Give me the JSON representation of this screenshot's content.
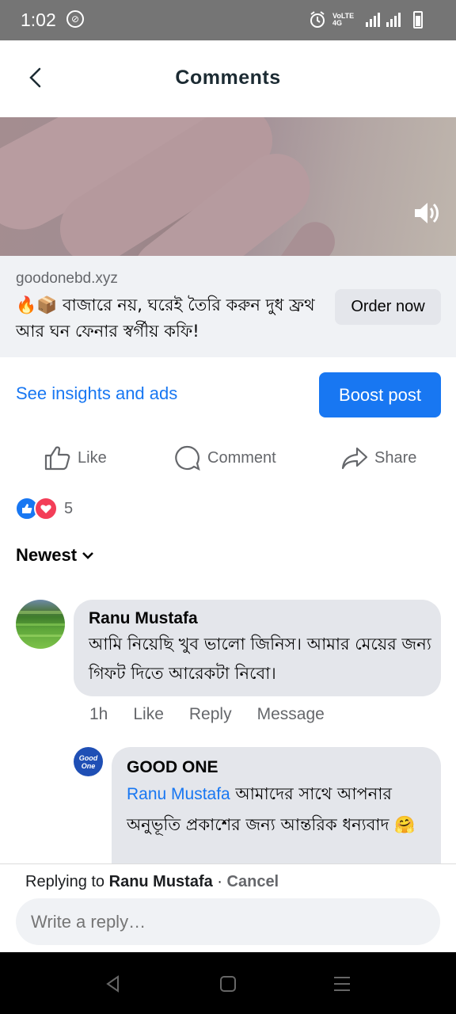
{
  "status": {
    "time": "1:02",
    "network_label": "VoLTE 4G"
  },
  "header": {
    "title": "Comments"
  },
  "ad": {
    "domain": "goodonebd.xyz",
    "emojis": "🔥📦",
    "text": "বাজারে নয়, ঘরেই তৈরি করুন দুধ ফ্রথ আর ঘন ফেনার স্বর্গীয় কফি!",
    "cta": "Order now"
  },
  "insights": {
    "link": "See insights and ads",
    "boost": "Boost post"
  },
  "actions": {
    "like": "Like",
    "comment": "Comment",
    "share": "Share"
  },
  "reactions": {
    "count": "5"
  },
  "sort": {
    "label": "Newest"
  },
  "comments": [
    {
      "author": "Ranu Mustafa",
      "text": "আমি নিয়েছি খুব ভালো জিনিস। আমার মেয়ের জন্য গিফট দিতে আরেকটা নিবো।",
      "time": "1h",
      "like": "Like",
      "reply": "Reply",
      "message": "Message"
    },
    {
      "author": "GOOD ONE",
      "mention": "Ranu Mustafa",
      "text": " আমাদের সাথে আপনার অনুভূতি প্রকাশের জন্য আন্তরিক ধন্যবাদ 🤗",
      "avatar_text": "Good One"
    }
  ],
  "reply": {
    "prefix": "Replying to ",
    "name": "Ranu Mustafa",
    "sep": " · ",
    "cancel": "Cancel",
    "placeholder": "Write a reply…"
  },
  "colors": {
    "accent": "#1877f2",
    "status_bar": "#757575",
    "bubble": "#e4e6eb"
  }
}
